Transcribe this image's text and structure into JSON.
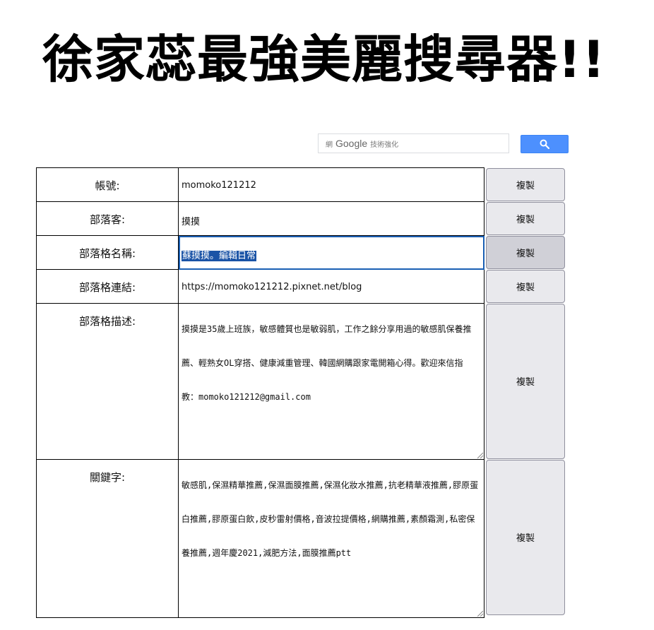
{
  "page_title": "徐家蕊最強美麗搜尋器!!",
  "search": {
    "brand_prefix": "網",
    "brand_google": "Google",
    "brand_suffix": "技術強化",
    "button_icon": "search-icon",
    "button_color": "#4d90fe"
  },
  "rows": [
    {
      "label": "帳號:",
      "value": "momoko121212",
      "button": "複製"
    },
    {
      "label": "部落客:",
      "value": "摸摸",
      "button": "複製"
    },
    {
      "label": "部落格名稱:",
      "value": "蘇摸摸。編輯日常",
      "button": "複製",
      "selected": true
    },
    {
      "label": "部落格連結:",
      "value": "https://momoko121212.pixnet.net/blog",
      "button": "複製"
    },
    {
      "label": "部落格描述:",
      "value": "摸摸是35歲上班族，敏感體質也是敏弱肌，工作之餘分享用過的敏感肌保養推薦、輕熟女OL穿搭、健康減重管理、韓國網購跟家電開箱心得。歡迎來信指教：momoko121212@gmail.com",
      "button": "複製"
    },
    {
      "label": "關鍵字:",
      "value": "敏感肌,保濕精華推薦,保濕面膜推薦,保濕化妝水推薦,抗老精華液推薦,膠原蛋白推薦,膠原蛋白飲,皮秒雷射價格,音波拉提價格,網購推薦,素顏霜測,私密保養推薦,週年慶2021,減肥方法,面膜推薦ptt",
      "button": "複製"
    }
  ],
  "colors": {
    "selection": "#1a53a6",
    "focus_outline": "#1a5fb4",
    "button_bg": "#e9e9ed"
  }
}
